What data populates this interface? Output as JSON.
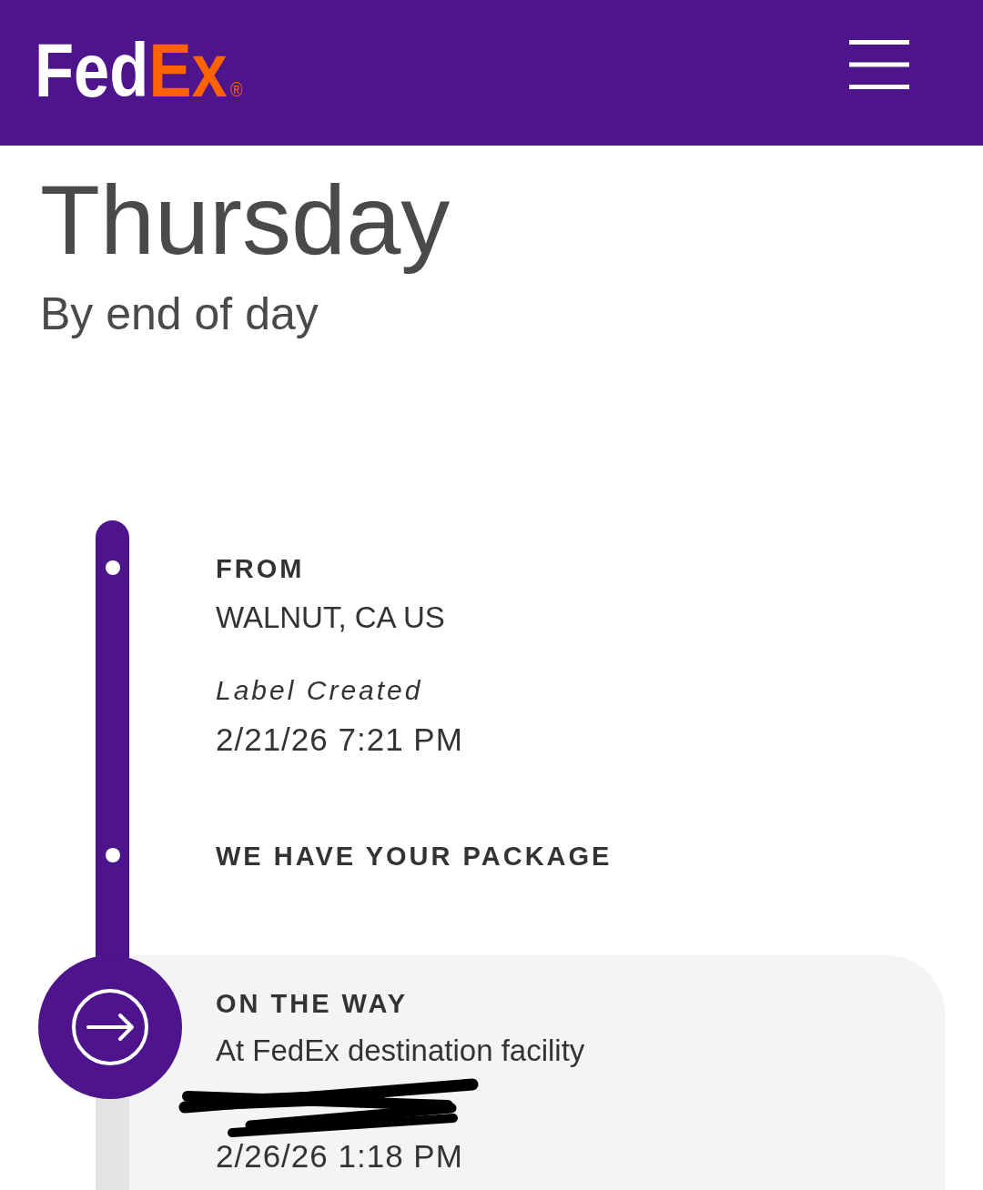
{
  "header": {
    "logo": {
      "primary": "Fed",
      "accent": "Ex",
      "mark": "®"
    }
  },
  "delivery": {
    "day": "Thursday",
    "window": "By end of day"
  },
  "timeline": {
    "steps": [
      {
        "title": "FROM",
        "location": "WALNUT, CA US",
        "event": "Label Created",
        "time": "2/21/26 7:21 PM",
        "current": false
      },
      {
        "title": "WE HAVE YOUR PACKAGE",
        "current": false
      },
      {
        "title": "ON THE WAY",
        "status": "At FedEx destination facility",
        "redacted": true,
        "time": "2/26/26 1:18 PM",
        "current": true
      }
    ]
  }
}
